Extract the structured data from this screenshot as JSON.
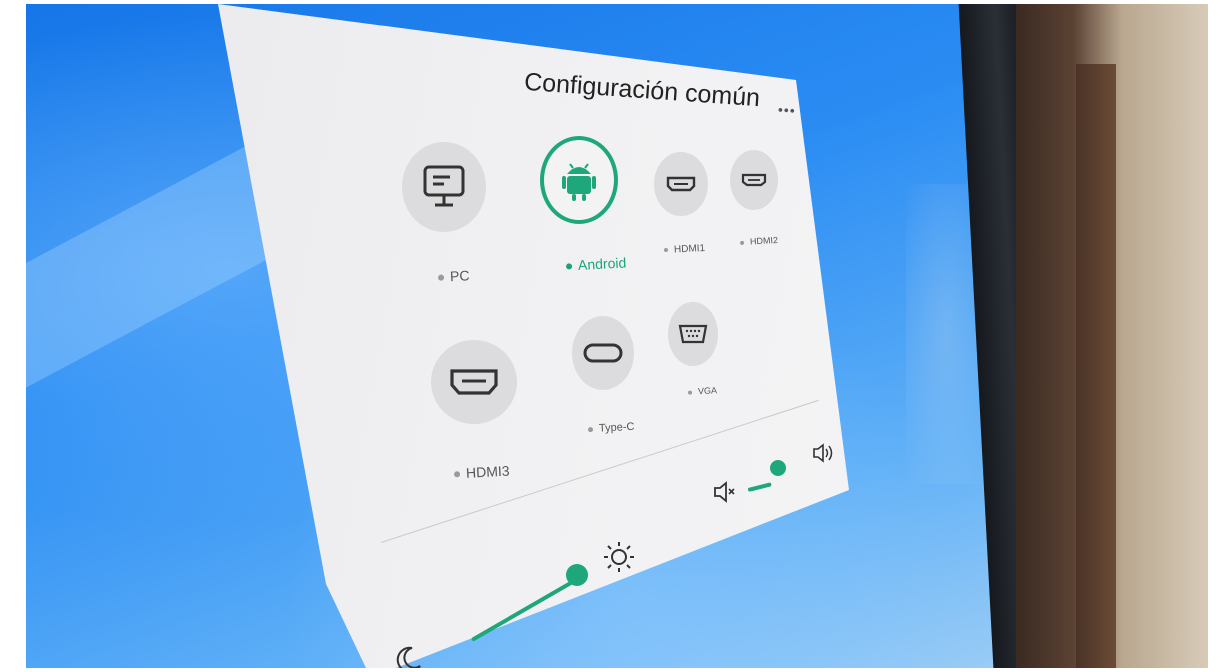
{
  "panel": {
    "title": "Configuración común",
    "more_label": "•••"
  },
  "sources": [
    {
      "label": "PC",
      "icon": "monitor-icon",
      "active": false
    },
    {
      "label": "Android",
      "icon": "android-icon",
      "active": true
    },
    {
      "label": "HDMI1",
      "icon": "hdmi-icon",
      "active": false
    },
    {
      "label": "HDMI2",
      "icon": "hdmi-icon",
      "active": false
    },
    {
      "label": "HDMI3",
      "icon": "hdmi-icon",
      "active": false
    },
    {
      "label": "Type-C",
      "icon": "usb-c-icon",
      "active": false
    },
    {
      "label": "VGA",
      "icon": "vga-icon",
      "active": false
    }
  ],
  "controls": {
    "brightness_level": 0.8,
    "volume_level": 0.6
  },
  "colors": {
    "accent": "#1ea77b",
    "panel": "#f1f1f3",
    "screen_blue": "#2a8cf3"
  }
}
